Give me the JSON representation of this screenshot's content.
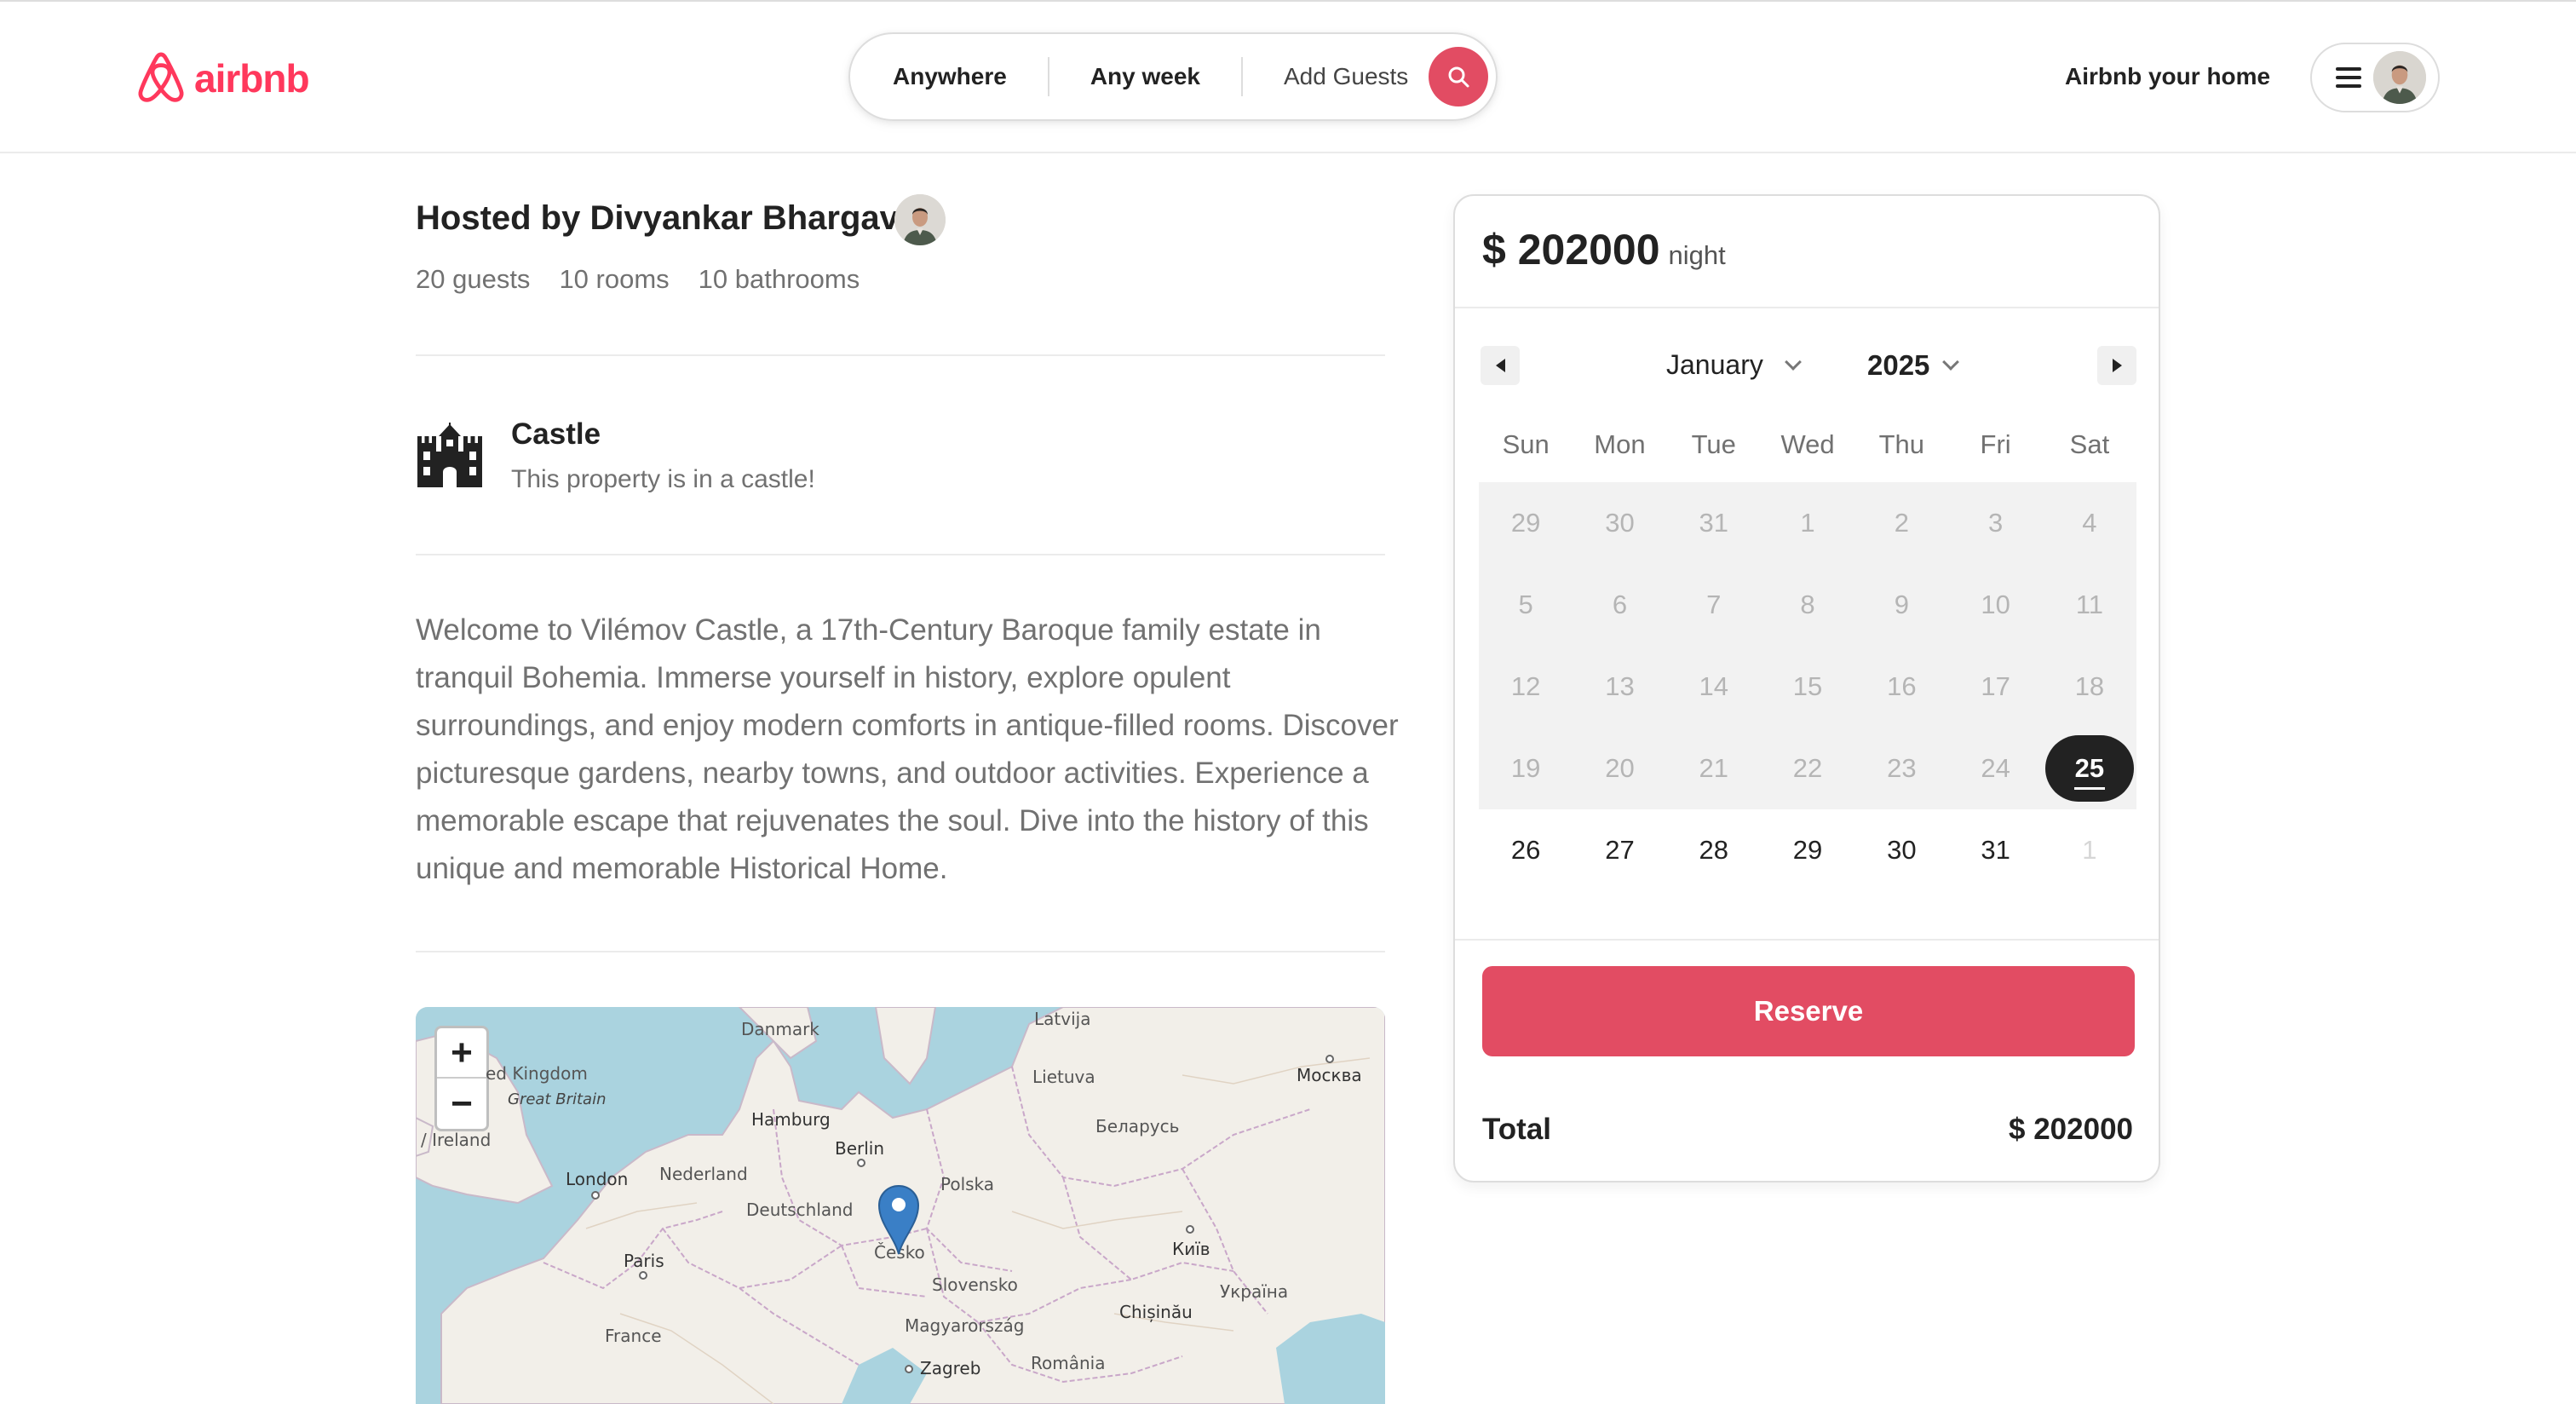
{
  "brand": {
    "name": "airbnb",
    "color": "#ff385c"
  },
  "search": {
    "location": "Anywhere",
    "dates": "Any week",
    "guests": "Add Guests",
    "button_icon": "search-icon"
  },
  "header": {
    "host_link": "Airbnb your home",
    "menu_icon": "hamburger-menu-icon"
  },
  "listing": {
    "host_title": "Hosted by Divyankar Bhargav",
    "stats": [
      "20 guests",
      "10 rooms",
      "10 bathrooms"
    ],
    "category_title": "Castle",
    "category_subtitle": "This property is in a castle!",
    "category_icon": "castle-icon",
    "description": "Welcome to Vilémov Castle, a 17th-Century Baroque family estate in tranquil Bohemia. Immerse yourself in history, explore opulent surroundings, and enjoy modern comforts in antique-filled rooms. Discover picturesque gardens, nearby towns, and outdoor activities. Experience a memorable escape that rejuvenates the soul. Dive into the history of this unique and memorable Historical Home."
  },
  "map": {
    "zoom_in": "+",
    "zoom_out": "−",
    "labels": {
      "latvija": "Latvija",
      "danmark": "Danmark",
      "united_kingdom": "ed Kingdom",
      "great_britain": "Great Britain",
      "ireland": "/ Ireland",
      "lietuva": "Lietuva",
      "moskva": "Москва",
      "hamburg": "Hamburg",
      "belarus": "Беларусь",
      "berlin": "Berlin",
      "nederland": "Nederland",
      "london": "London",
      "polska": "Polska",
      "deutschland": "Deutschland",
      "kyiv": "Київ",
      "paris": "Paris",
      "cesko": "Česko",
      "slovensko": "Slovensko",
      "ukraina": "Україна",
      "chisinau": "Chișinău",
      "france": "France",
      "magyarorszag": "Magyarország",
      "zagreb": "Zagreb",
      "romania": "România"
    }
  },
  "booking": {
    "price": "$ 202000",
    "price_unit": "night",
    "month": "January",
    "year": "2025",
    "weekdays": [
      "Sun",
      "Mon",
      "Tue",
      "Wed",
      "Thu",
      "Fri",
      "Sat"
    ],
    "days": [
      {
        "d": "29",
        "state": "blocked"
      },
      {
        "d": "30",
        "state": "blocked"
      },
      {
        "d": "31",
        "state": "blocked"
      },
      {
        "d": "1",
        "state": "blocked"
      },
      {
        "d": "2",
        "state": "blocked"
      },
      {
        "d": "3",
        "state": "blocked"
      },
      {
        "d": "4",
        "state": "blocked"
      },
      {
        "d": "5",
        "state": "blocked"
      },
      {
        "d": "6",
        "state": "blocked"
      },
      {
        "d": "7",
        "state": "blocked"
      },
      {
        "d": "8",
        "state": "blocked"
      },
      {
        "d": "9",
        "state": "blocked"
      },
      {
        "d": "10",
        "state": "blocked"
      },
      {
        "d": "11",
        "state": "blocked"
      },
      {
        "d": "12",
        "state": "blocked"
      },
      {
        "d": "13",
        "state": "blocked"
      },
      {
        "d": "14",
        "state": "blocked"
      },
      {
        "d": "15",
        "state": "blocked"
      },
      {
        "d": "16",
        "state": "blocked"
      },
      {
        "d": "17",
        "state": "blocked"
      },
      {
        "d": "18",
        "state": "blocked"
      },
      {
        "d": "19",
        "state": "blocked"
      },
      {
        "d": "20",
        "state": "blocked"
      },
      {
        "d": "21",
        "state": "blocked"
      },
      {
        "d": "22",
        "state": "blocked"
      },
      {
        "d": "23",
        "state": "blocked"
      },
      {
        "d": "24",
        "state": "blocked"
      },
      {
        "d": "25",
        "state": "today"
      },
      {
        "d": "26",
        "state": "active"
      },
      {
        "d": "27",
        "state": "active"
      },
      {
        "d": "28",
        "state": "active"
      },
      {
        "d": "29",
        "state": "active"
      },
      {
        "d": "30",
        "state": "active"
      },
      {
        "d": "31",
        "state": "active"
      },
      {
        "d": "1",
        "state": "outside"
      }
    ],
    "reserve_label": "Reserve",
    "total_label": "Total",
    "total_value": "$ 202000",
    "accent_color": "#e24c63"
  }
}
